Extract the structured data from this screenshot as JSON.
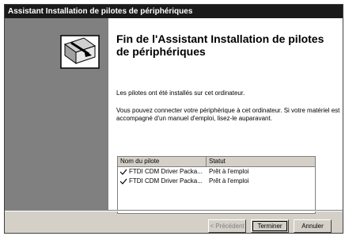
{
  "window": {
    "title": "Assistant Installation de pilotes de périphériques"
  },
  "wizard": {
    "heading": "Fin de l'Assistant Installation de pilotes de périphériques",
    "paragraph1": "Les pilotes ont été installés sur cet ordinateur.",
    "paragraph2": "Vous pouvez connecter votre périphérique à cet ordinateur. Si votre matériel est accompagné d'un manuel d'emploi, lisez-le auparavant.",
    "icon": "wizard-drive-icon"
  },
  "driver_list": {
    "columns": [
      "Nom du pilote",
      "Statut"
    ],
    "rows": [
      {
        "name": "FTDI CDM Driver Packa...",
        "status": "Prêt à l'emploi",
        "icon": "check-icon"
      },
      {
        "name": "FTDI CDM Driver Packa...",
        "status": "Prêt à l'emploi",
        "icon": "check-icon"
      }
    ]
  },
  "buttons": {
    "previous": "< Précédent",
    "finish": "Terminer",
    "cancel": "Annuler"
  }
}
